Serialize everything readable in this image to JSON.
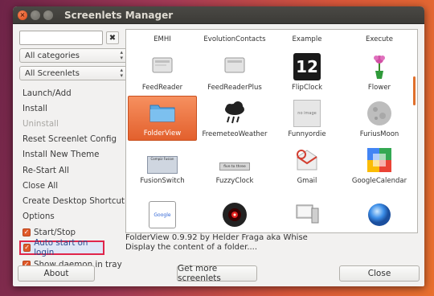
{
  "window": {
    "title": "Screenlets Manager"
  },
  "left": {
    "search": {
      "value": "",
      "placeholder": ""
    },
    "category_combo": "All categories",
    "screenlet_combo": "All Screenlets",
    "menu": [
      {
        "label": "Launch/Add",
        "enabled": true
      },
      {
        "label": "Install",
        "enabled": true
      },
      {
        "label": "Uninstall",
        "enabled": false
      },
      {
        "label": "Reset Screenlet Config",
        "enabled": true
      },
      {
        "label": "Install New Theme",
        "enabled": true
      },
      {
        "label": "Re-Start All",
        "enabled": true
      },
      {
        "label": "Close All",
        "enabled": true
      },
      {
        "label": "Create Desktop Shortcut",
        "enabled": true
      },
      {
        "label": "Options",
        "enabled": true
      }
    ],
    "checkboxes": [
      {
        "label": "Start/Stop",
        "checked": true
      },
      {
        "label": "Auto start on login",
        "checked": true,
        "highlighted": true
      },
      {
        "label": "Show daemon in tray",
        "checked": true
      }
    ]
  },
  "grid": {
    "items": [
      {
        "label": "EMHI",
        "icon": "none"
      },
      {
        "label": "EvolutionContacts",
        "icon": "none"
      },
      {
        "label": "Example",
        "icon": "none"
      },
      {
        "label": "Execute",
        "icon": "none"
      },
      {
        "label": "FeedReader",
        "icon": "feedreader-icon"
      },
      {
        "label": "FeedReaderPlus",
        "icon": "feedreaderplus-icon"
      },
      {
        "label": "FlipClock",
        "icon": "flipclock-icon",
        "icon_text": "12"
      },
      {
        "label": "Flower",
        "icon": "flower-icon"
      },
      {
        "label": "FolderView",
        "icon": "folder-icon",
        "selected": true
      },
      {
        "label": "FreemeteoWeather",
        "icon": "rain-cloud-icon"
      },
      {
        "label": "Funnyordie",
        "icon": "no-image-icon",
        "icon_text": "no image"
      },
      {
        "label": "FuriusMoon",
        "icon": "moon-icon"
      },
      {
        "label": "FusionSwitch",
        "icon": "fusionswitch-icon",
        "icon_text": "Compiz Fusion"
      },
      {
        "label": "FuzzyClock",
        "icon": "fuzzyclock-icon",
        "icon_text": "five to three"
      },
      {
        "label": "Gmail",
        "icon": "gmail-icon"
      },
      {
        "label": "GoogleCalendar",
        "icon": "google-calendar-icon"
      },
      {
        "label": "",
        "icon": "google-icon",
        "icon_text": "Google"
      },
      {
        "label": "",
        "icon": "hal-icon"
      },
      {
        "label": "",
        "icon": "computer-icon"
      },
      {
        "label": "",
        "icon": "blue-orb-icon"
      }
    ]
  },
  "info": {
    "line1": "FolderView 0.9.92 by Helder Fraga aka Whise",
    "line2": "Display the content of a folder...."
  },
  "buttons": {
    "about": "About",
    "more": "Get more screenlets",
    "close": "Close"
  },
  "colors": {
    "accent": "#e3602d",
    "highlight_border": "#e0254a"
  }
}
